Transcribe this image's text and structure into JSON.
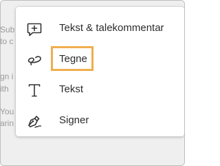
{
  "background": {
    "lines": [
      "Sub",
      "to c",
      "gn i",
      "ith",
      "You",
      "arin"
    ]
  },
  "menu": {
    "items": [
      {
        "label": "Tekst & talekommentar",
        "icon": "comment-add-icon"
      },
      {
        "label": "Tegne",
        "icon": "freehand-draw-icon"
      },
      {
        "label": "Tekst",
        "icon": "text-icon"
      },
      {
        "label": "Signer",
        "icon": "signature-pen-icon"
      }
    ],
    "highlighted_item": "Tegne",
    "highlight_color": "#f0ad4e"
  }
}
